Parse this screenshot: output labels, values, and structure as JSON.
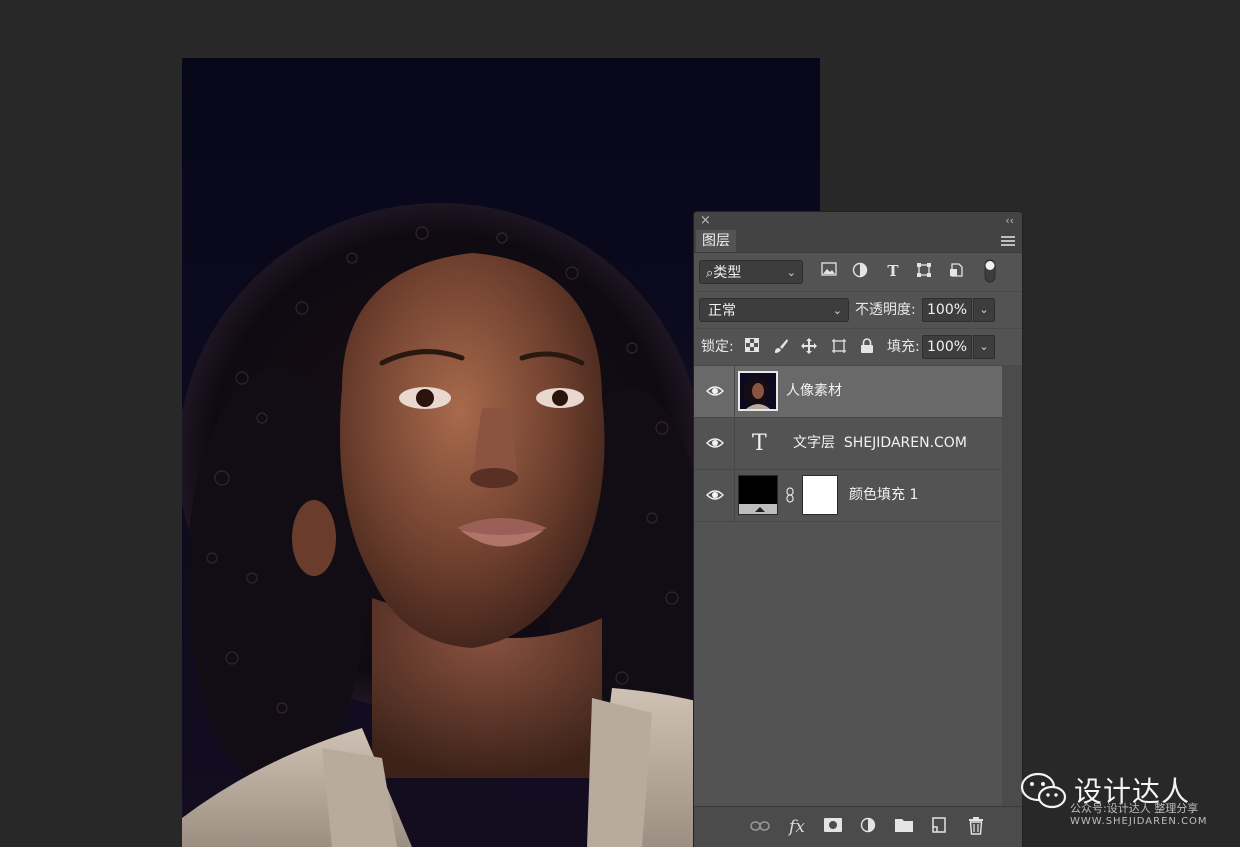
{
  "colors": {
    "workspace_bg": "#282828",
    "panel_bg": "#535353",
    "panel_header_bg": "#434343",
    "selected_layer_bg": "#696969",
    "field_bg": "#3d3d3d"
  },
  "canvas": {
    "photo_description_icon": "portrait-photo"
  },
  "panel": {
    "close_icon": "×",
    "collapse_icon": "‹‹",
    "tab_label": "图层",
    "filter": {
      "icon": "⌕",
      "value": "类型"
    },
    "filter_icons": [
      "image-filter-icon",
      "adjustment-filter-icon",
      "type-filter-icon",
      "shape-filter-icon",
      "smart-object-filter-icon",
      "filter-toggle-icon"
    ],
    "blend_mode": "正常",
    "opacity_label": "不透明度:",
    "opacity_value": "100%",
    "lock_label": "锁定:",
    "fill_label": "填充:",
    "fill_value": "100%",
    "type_glyph": "T",
    "layers": [
      {
        "name": "人像素材",
        "type": "image",
        "visible": true,
        "selected": true
      },
      {
        "name": "文字层  SHEJIDAREN.COM",
        "type": "text",
        "visible": true,
        "selected": false
      },
      {
        "name": "颜色填充 1",
        "type": "fill",
        "visible": true,
        "selected": false
      }
    ],
    "bottom_icons": [
      "link-layers-icon",
      "fx-icon",
      "add-mask-icon",
      "adjustment-layer-icon",
      "new-group-icon",
      "new-layer-icon",
      "delete-layer-icon"
    ],
    "fx_label": "fx"
  },
  "watermark": {
    "title": "设计达人",
    "subtitle": "公众号:设计达人  整理分享",
    "url": "WWW.SHEJIDAREN.COM"
  }
}
